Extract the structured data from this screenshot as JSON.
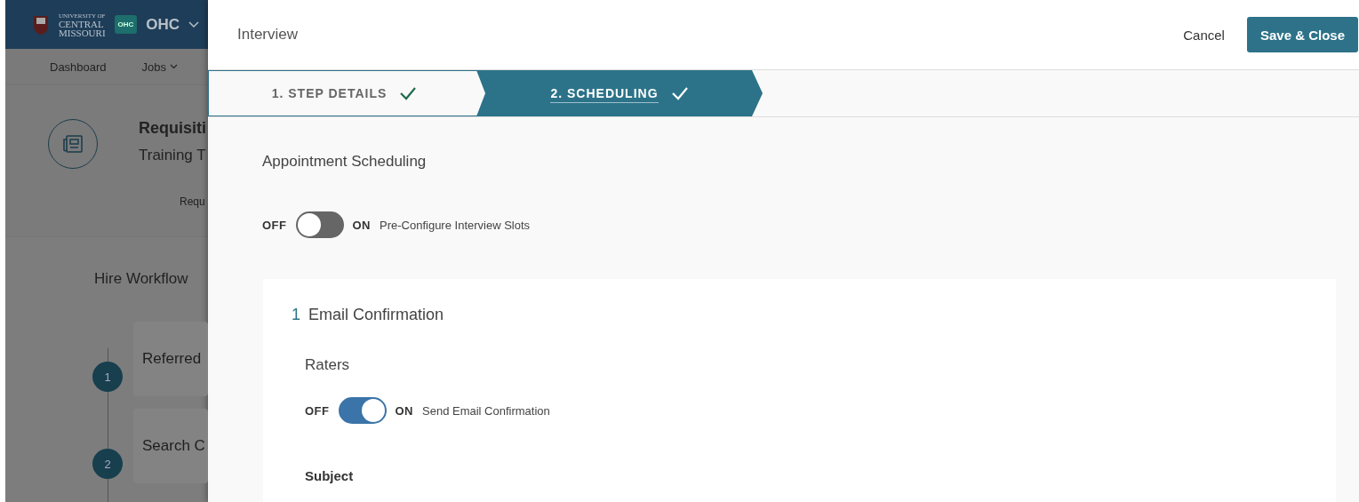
{
  "background_app": {
    "logo_text": [
      "UNIVERSITY OF",
      "CENTRAL",
      "MISSOURI"
    ],
    "app_badge": "OHC",
    "app_name": "OHC",
    "nav": [
      {
        "label": "Dashboard",
        "has_menu": false
      },
      {
        "label": "Jobs",
        "has_menu": true
      }
    ],
    "requisition": {
      "title": "Requisiti",
      "subtitle": "Training T",
      "tab": "Requ"
    },
    "workflow": {
      "title": "Hire Workflow",
      "steps": [
        {
          "number": "1",
          "label": "Referred"
        },
        {
          "number": "2",
          "label": "Search C"
        }
      ]
    }
  },
  "drawer": {
    "title": "Interview",
    "cancel": "Cancel",
    "save": "Save & Close",
    "steps": [
      {
        "label": "1. STEP DETAILS",
        "selected": false,
        "complete": true
      },
      {
        "label": "2. SCHEDULING",
        "selected": true,
        "complete": true
      }
    ],
    "section_title": "Appointment Scheduling",
    "slots_toggle": {
      "off_label": "OFF",
      "on_label": "ON",
      "on": false,
      "label": "Pre-Configure Interview Slots"
    },
    "card": {
      "number": "1",
      "title": "Email Confirmation",
      "group": "Raters",
      "toggle": {
        "off_label": "OFF",
        "on_label": "ON",
        "on": true,
        "label": "Send Email Confirmation"
      },
      "field_label": "Subject"
    }
  }
}
